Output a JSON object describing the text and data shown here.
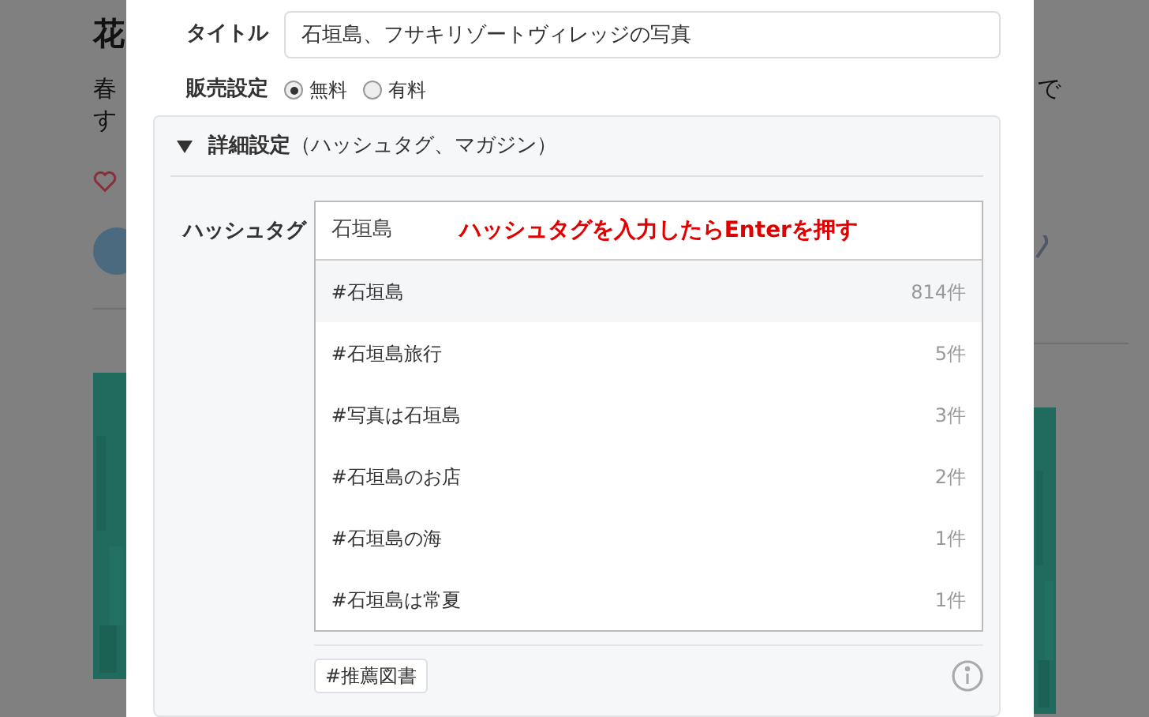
{
  "background_page": {
    "title": "花",
    "text_left": [
      "春",
      "す"
    ],
    "text_right": "で"
  },
  "dialog": {
    "title_field": {
      "label": "タイトル",
      "value": "石垣島、フサキリゾートヴィレッジの写真"
    },
    "sales": {
      "label": "販売設定",
      "options": [
        {
          "label": "無料",
          "selected": true
        },
        {
          "label": "有料",
          "selected": false
        }
      ]
    },
    "details": {
      "expanded": true,
      "heading": "詳細設定",
      "heading_note": "（ハッシュタグ、マガジン）",
      "hashtag": {
        "label": "ハッシュタグ",
        "value": "石垣島",
        "annotation": "ハッシュタグを入力したらEnterを押す",
        "suggestions": [
          {
            "tag": "#石垣島",
            "count": "814件",
            "selected": true
          },
          {
            "tag": "#石垣島旅行",
            "count": "5件",
            "selected": false
          },
          {
            "tag": "#写真は石垣島",
            "count": "3件",
            "selected": false
          },
          {
            "tag": "#石垣島のお店",
            "count": "2件",
            "selected": false
          },
          {
            "tag": "#石垣島の海",
            "count": "1件",
            "selected": false
          },
          {
            "tag": "#石垣島は常夏",
            "count": "1件",
            "selected": false
          }
        ],
        "tags": [
          "#推薦図書"
        ]
      }
    }
  }
}
